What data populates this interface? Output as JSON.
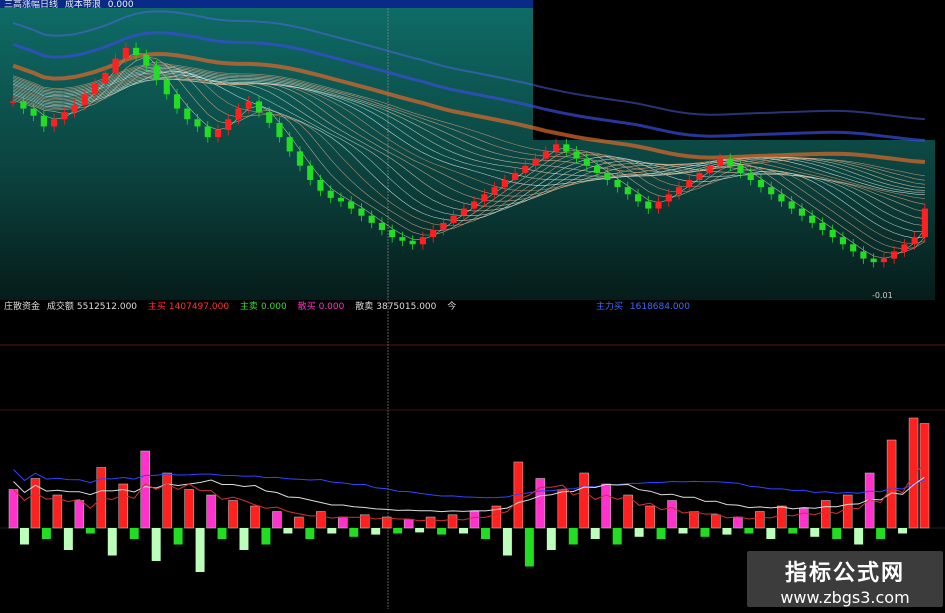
{
  "header": {
    "indicator_name": "三高涨幅日线",
    "indicator_name2": "成本带浪",
    "indicator_value": "0.000"
  },
  "volume_panel": {
    "name": "庄散资金",
    "items": [
      {
        "label": "成交额",
        "value": "5512512.000"
      },
      {
        "label": "主买",
        "value": "1407497.000"
      },
      {
        "label": "主卖",
        "value": "0.000"
      },
      {
        "label": "散买",
        "value": "0.000"
      },
      {
        "label": "散卖",
        "value": "3875015.000"
      },
      {
        "label": "今",
        "value": ""
      }
    ],
    "right_label": "主力买",
    "right_value": "1618684.000"
  },
  "price_annotation": "-0.01",
  "watermark": {
    "title": "指标公式网",
    "url": "www.zbgs3.com"
  },
  "colors": {
    "up": "#ff2020",
    "down": "#22dd22",
    "magenta": "#ff33cc",
    "outline": "#cfcfcf",
    "teal_bg": "#0e6b66",
    "blue_band": "#3a4bd8",
    "orange_band": "#e06a2a"
  },
  "chart_data": [
    {
      "type": "candlestick",
      "title": "",
      "note": "Price candles overlaid with fan of moving-average lines and cost bands",
      "candles_close": [
        1.0,
        0.98,
        0.96,
        0.93,
        0.95,
        0.97,
        0.99,
        1.02,
        1.05,
        1.08,
        1.12,
        1.15,
        1.13,
        1.1,
        1.06,
        1.02,
        0.98,
        0.95,
        0.93,
        0.9,
        0.92,
        0.95,
        0.98,
        1.0,
        0.97,
        0.94,
        0.9,
        0.86,
        0.82,
        0.78,
        0.75,
        0.73,
        0.72,
        0.7,
        0.68,
        0.66,
        0.64,
        0.62,
        0.61,
        0.6,
        0.62,
        0.64,
        0.66,
        0.68,
        0.7,
        0.72,
        0.74,
        0.76,
        0.78,
        0.8,
        0.82,
        0.84,
        0.86,
        0.88,
        0.86,
        0.84,
        0.82,
        0.8,
        0.78,
        0.76,
        0.74,
        0.72,
        0.7,
        0.72,
        0.74,
        0.76,
        0.78,
        0.8,
        0.82,
        0.84,
        0.82,
        0.8,
        0.78,
        0.76,
        0.74,
        0.72,
        0.7,
        0.68,
        0.66,
        0.64,
        0.62,
        0.6,
        0.58,
        0.56,
        0.55,
        0.56,
        0.58,
        0.6,
        0.62,
        0.7
      ]
    },
    {
      "type": "bar",
      "title": "",
      "note": "Volume / capital-flow histogram; positive above zero line, negative below",
      "values": [
        0.35,
        -0.15,
        0.45,
        -0.1,
        0.3,
        -0.2,
        0.25,
        -0.05,
        0.55,
        -0.25,
        0.4,
        -0.1,
        0.7,
        -0.3,
        0.5,
        -0.15,
        0.35,
        -0.4,
        0.3,
        -0.1,
        0.25,
        -0.2,
        0.2,
        -0.15,
        0.15,
        -0.05,
        0.1,
        -0.1,
        0.15,
        -0.05,
        0.1,
        -0.08,
        0.12,
        -0.06,
        0.1,
        -0.05,
        0.08,
        -0.04,
        0.1,
        -0.06,
        0.12,
        -0.05,
        0.15,
        -0.1,
        0.2,
        -0.25,
        0.6,
        -0.35,
        0.45,
        -0.2,
        0.35,
        -0.15,
        0.5,
        -0.1,
        0.4,
        -0.15,
        0.3,
        -0.08,
        0.2,
        -0.1,
        0.25,
        -0.05,
        0.15,
        -0.08,
        0.12,
        -0.06,
        0.1,
        -0.05,
        0.15,
        -0.1,
        0.2,
        -0.05,
        0.18,
        -0.08,
        0.25,
        -0.1,
        0.3,
        -0.15,
        0.5,
        -0.1,
        0.8,
        -0.05,
        1.0,
        0.95
      ]
    }
  ]
}
